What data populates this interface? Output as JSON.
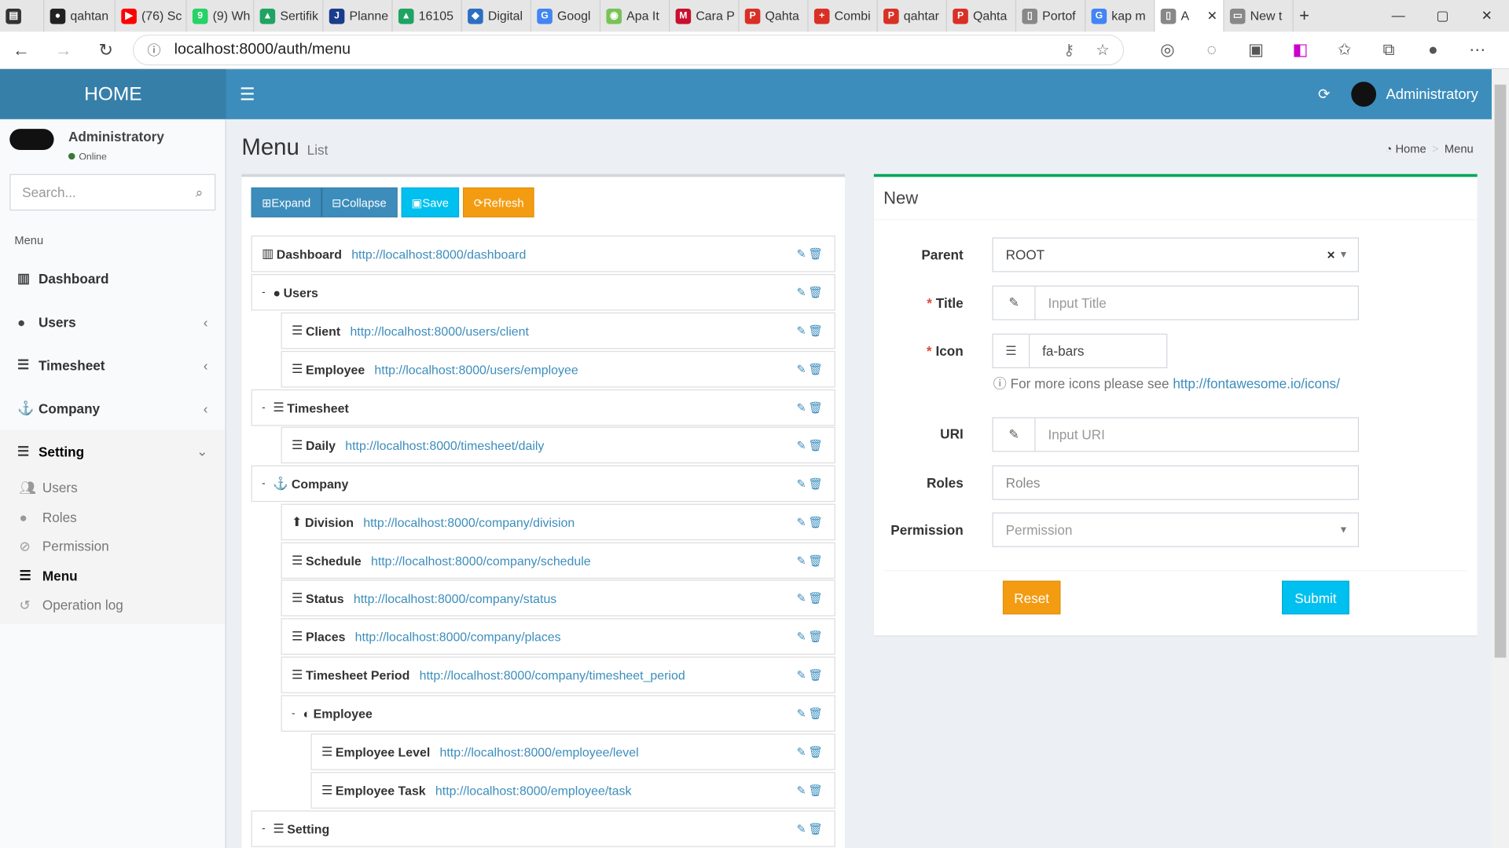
{
  "browser": {
    "tabs": [
      {
        "label": "",
        "icon": "sidebar-icon",
        "color": "#333"
      },
      {
        "label": "qahtan",
        "icon": "github-icon",
        "color": "#222"
      },
      {
        "label": "(76) Sc",
        "icon": "youtube-icon",
        "color": "#ff0000"
      },
      {
        "label": "(9) Wh",
        "icon": "whatsapp-icon",
        "color": "#25d366"
      },
      {
        "label": "Sertifik",
        "icon": "drive-icon",
        "color": "#1fa463"
      },
      {
        "label": "Planne",
        "icon": "jira-icon",
        "color": "#1a3c8c"
      },
      {
        "label": "16105",
        "icon": "drive-icon",
        "color": "#1fa463"
      },
      {
        "label": "Digital",
        "icon": "box-icon",
        "color": "#2c6fc1"
      },
      {
        "label": "Googl",
        "icon": "translate-icon",
        "color": "#4285f4"
      },
      {
        "label": "Apa It",
        "icon": "android-icon",
        "color": "#78c257"
      },
      {
        "label": "Cara P",
        "icon": "m-icon",
        "color": "#c8102e"
      },
      {
        "label": "Qahta",
        "icon": "pdf-icon",
        "color": "#d93025"
      },
      {
        "label": "Combi",
        "icon": "pdf-tool-icon",
        "color": "#d93025"
      },
      {
        "label": "qahtar",
        "icon": "pdf-icon",
        "color": "#d93025"
      },
      {
        "label": "Qahta",
        "icon": "pdf-icon",
        "color": "#d93025"
      },
      {
        "label": "Portof",
        "icon": "doc-icon",
        "color": "#666"
      },
      {
        "label": "kap m",
        "icon": "google-icon",
        "color": "#4285f4"
      },
      {
        "label": "A",
        "icon": "doc-icon",
        "color": "#666"
      },
      {
        "label": "New t",
        "icon": "newtab-icon",
        "color": "#666"
      }
    ],
    "url": "localhost:8000/auth/menu"
  },
  "header": {
    "logo": "HOME",
    "user": "Administratory"
  },
  "sidebar": {
    "user_name": "Administratory",
    "user_status": "Online",
    "search_placeholder": "Search...",
    "menu_header": "Menu",
    "items": [
      {
        "label": "Dashboard",
        "icon": "bar-chart-icon"
      },
      {
        "label": "Users",
        "icon": "user-icon"
      },
      {
        "label": "Timesheet",
        "icon": "bars-icon"
      },
      {
        "label": "Company",
        "icon": "anchor-icon"
      },
      {
        "label": "Setting",
        "icon": "bars-icon"
      }
    ],
    "sub_items": [
      {
        "label": "Users",
        "icon": "users-icon"
      },
      {
        "label": "Roles",
        "icon": "user-icon"
      },
      {
        "label": "Permission",
        "icon": "ban-icon"
      },
      {
        "label": "Menu",
        "icon": "bars-icon"
      },
      {
        "label": "Operation log",
        "icon": "history-icon"
      }
    ]
  },
  "page": {
    "title": "Menu",
    "subtitle": "List",
    "breadcrumb_home": "Home",
    "breadcrumb_current": "Menu"
  },
  "tree": {
    "buttons": {
      "expand": "Expand",
      "collapse": "Collapse",
      "save": "Save",
      "refresh": "Refresh"
    },
    "rows": [
      {
        "title": "Dashboard",
        "uri": "http://localhost:8000/dashboard",
        "toggle": ""
      },
      {
        "title": "Users",
        "uri": "",
        "toggle": "-"
      },
      {
        "title": "Client",
        "uri": "http://localhost:8000/users/client",
        "toggle": ""
      },
      {
        "title": "Employee",
        "uri": "http://localhost:8000/users/employee",
        "toggle": ""
      },
      {
        "title": "Timesheet",
        "uri": "",
        "toggle": "-"
      },
      {
        "title": "Daily",
        "uri": "http://localhost:8000/timesheet/daily",
        "toggle": ""
      },
      {
        "title": "Company",
        "uri": "",
        "toggle": "-"
      },
      {
        "title": "Division",
        "uri": "http://localhost:8000/company/division",
        "toggle": ""
      },
      {
        "title": "Schedule",
        "uri": "http://localhost:8000/company/schedule",
        "toggle": ""
      },
      {
        "title": "Status",
        "uri": "http://localhost:8000/company/status",
        "toggle": ""
      },
      {
        "title": "Places",
        "uri": "http://localhost:8000/company/places",
        "toggle": ""
      },
      {
        "title": "Timesheet Period",
        "uri": "http://localhost:8000/company/timesheet_period",
        "toggle": ""
      },
      {
        "title": "Employee",
        "uri": "",
        "toggle": "-"
      },
      {
        "title": "Employee Level",
        "uri": "http://localhost:8000/employee/level",
        "toggle": ""
      },
      {
        "title": "Employee Task",
        "uri": "http://localhost:8000/employee/task",
        "toggle": ""
      },
      {
        "title": "Setting",
        "uri": "",
        "toggle": "-"
      }
    ]
  },
  "form": {
    "title": "New",
    "parent_label": "Parent",
    "parent_value": "ROOT",
    "parent_clear": "×",
    "title_label": "Title",
    "title_placeholder": "Input Title",
    "icon_label": "Icon",
    "icon_value": "fa-bars",
    "help_text": "For more icons please see",
    "help_link": "http://fontawesome.io/icons/",
    "uri_label": "URI",
    "uri_placeholder": "Input URI",
    "roles_label": "Roles",
    "roles_placeholder": "Roles",
    "permission_label": "Permission",
    "permission_placeholder": "Permission",
    "reset": "Reset",
    "submit": "Submit",
    "colors": {
      "reset": "#f39c12",
      "submit": "#00c0ef"
    }
  }
}
